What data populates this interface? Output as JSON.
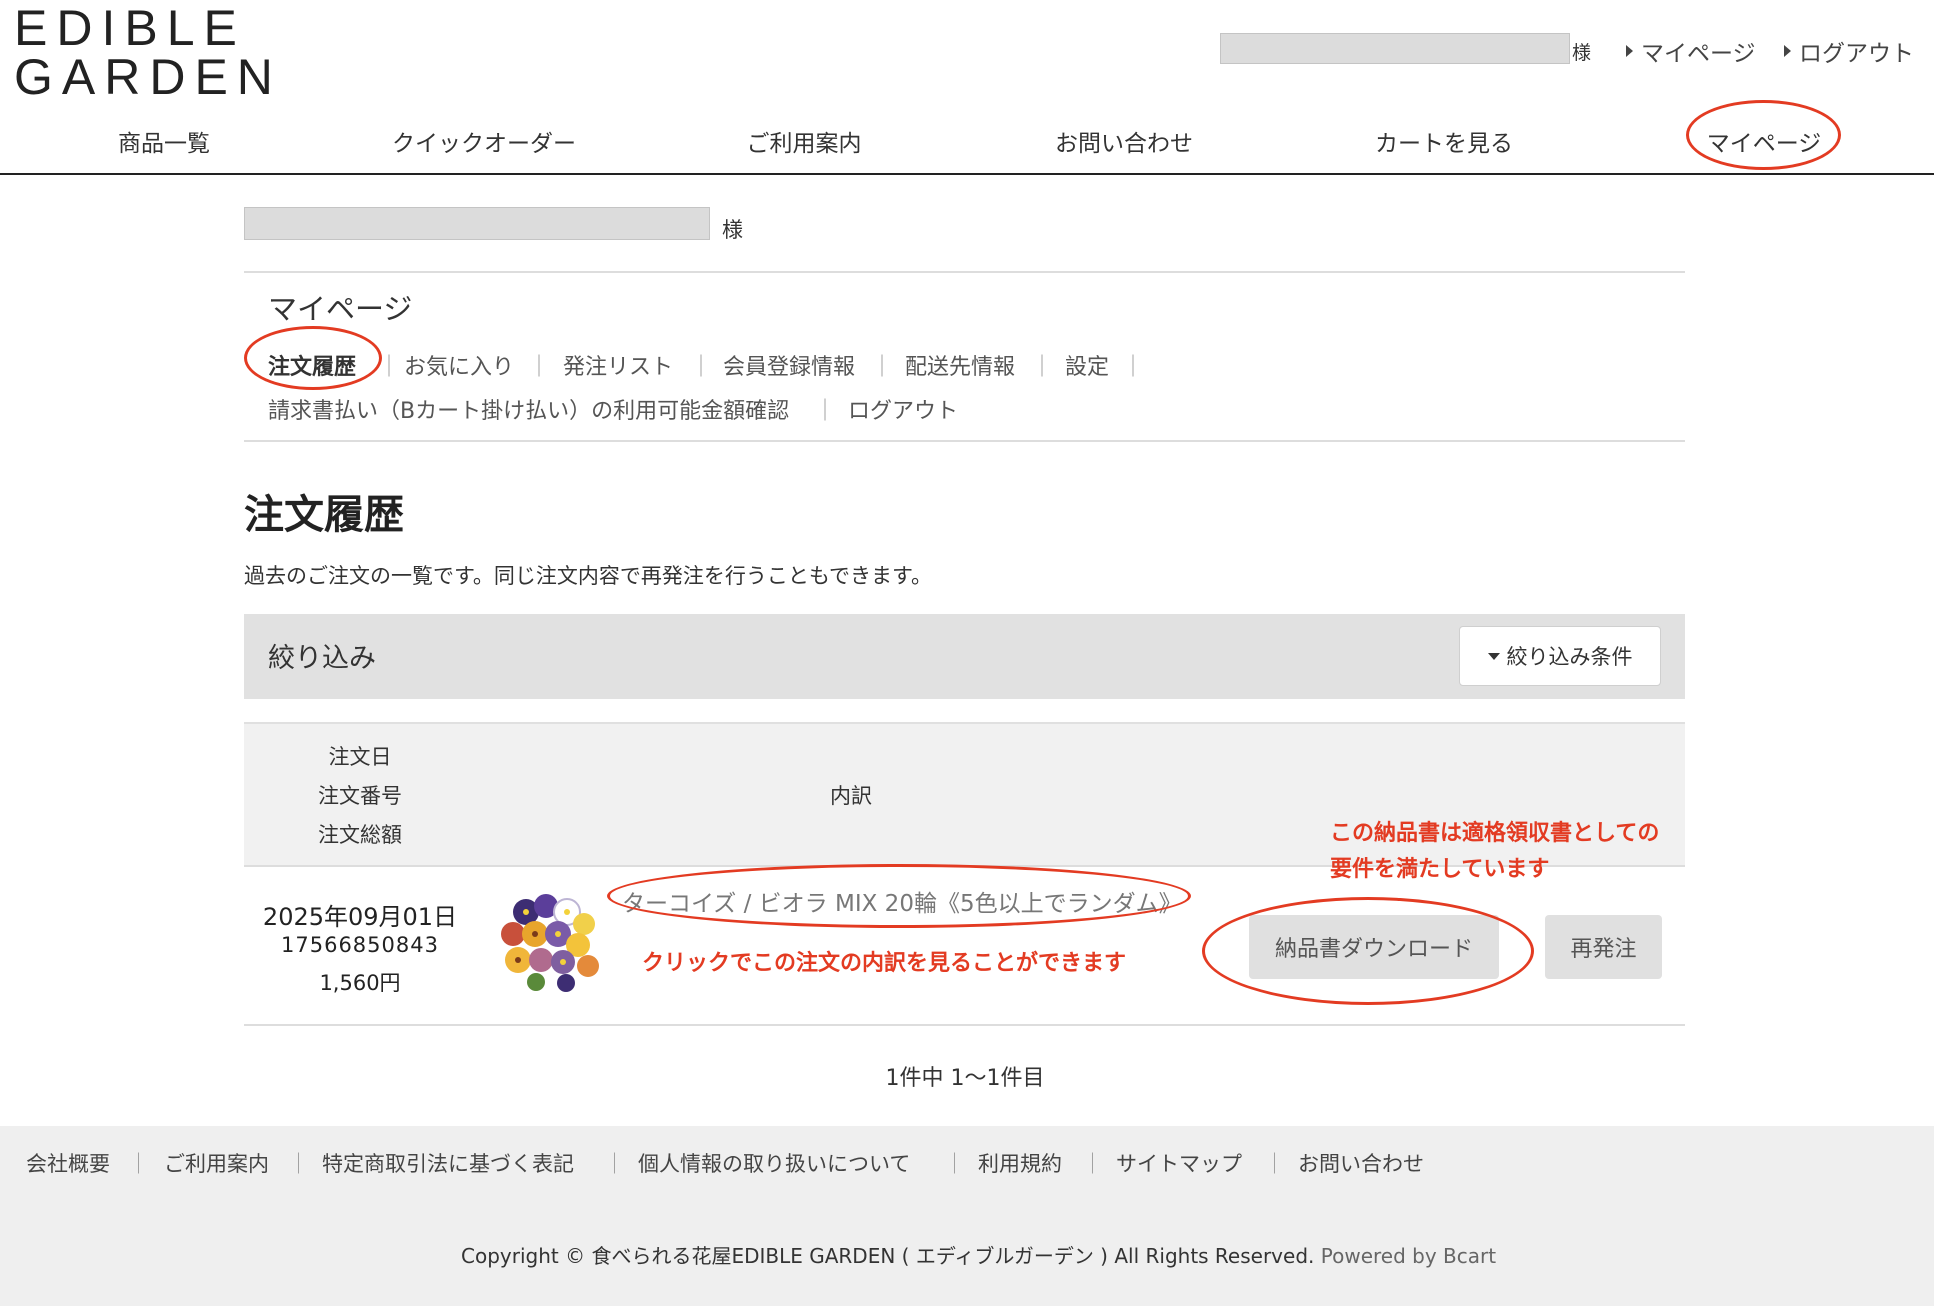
{
  "header": {
    "logo_line1": "EDIBLE",
    "logo_line2": "GARDEN",
    "user_suffix": "様",
    "links": {
      "mypage": "マイページ",
      "logout": "ログアウト"
    },
    "nav": [
      "商品一覧",
      "クイックオーダー",
      "ご利用案内",
      "お問い合わせ",
      "カートを見る",
      "マイページ"
    ]
  },
  "main": {
    "user_suffix": "様",
    "mypage_title": "マイページ",
    "subnav": {
      "order_history": "注文履歴",
      "favorites": "お気に入り",
      "order_list": "発注リスト",
      "member_info": "会員登録情報",
      "delivery_info": "配送先情報",
      "settings": "設定",
      "invoice_limit": "請求書払い（Bカート掛け払い）の利用可能金額確認",
      "logout": "ログアウト",
      "separator": "｜"
    },
    "page_title": "注文履歴",
    "description": "過去のご注文の一覧です。同じ注文内容で再発注を行うこともできます。",
    "filter": {
      "label": "絞り込み",
      "button": "絞り込み条件"
    },
    "table": {
      "headers": {
        "date": "注文日",
        "number": "注文番号",
        "total": "注文総額",
        "details": "内訳"
      },
      "rows": [
        {
          "date": "2025年09月01日",
          "number": "17566850843",
          "total": "1,560円",
          "product": "ターコイズ / ビオラ MIX 20輪《5色以上でランダム》",
          "download_label": "納品書ダウンロード",
          "reorder_label": "再発注"
        }
      ]
    },
    "pager": "1件中 1〜1件目"
  },
  "annotations": {
    "invoice_note_line1": "この納品書は適格領収書としての",
    "invoice_note_line2": "要件を満たしています",
    "click_note": "クリックでこの注文の内訳を見ることができます",
    "color": "#e33b22"
  },
  "footer": {
    "links": [
      "会社概要",
      "ご利用案内",
      "特定商取引法に基づく表記",
      "個人情報の取り扱いについて",
      "利用規約",
      "サイトマップ",
      "お問い合わせ"
    ],
    "separator": "｜",
    "copyright": "Copyright © 食べられる花屋EDIBLE GARDEN ( エディブルガーデン ) All Rights Reserved.",
    "powered_by": "Powered by Bcart"
  }
}
